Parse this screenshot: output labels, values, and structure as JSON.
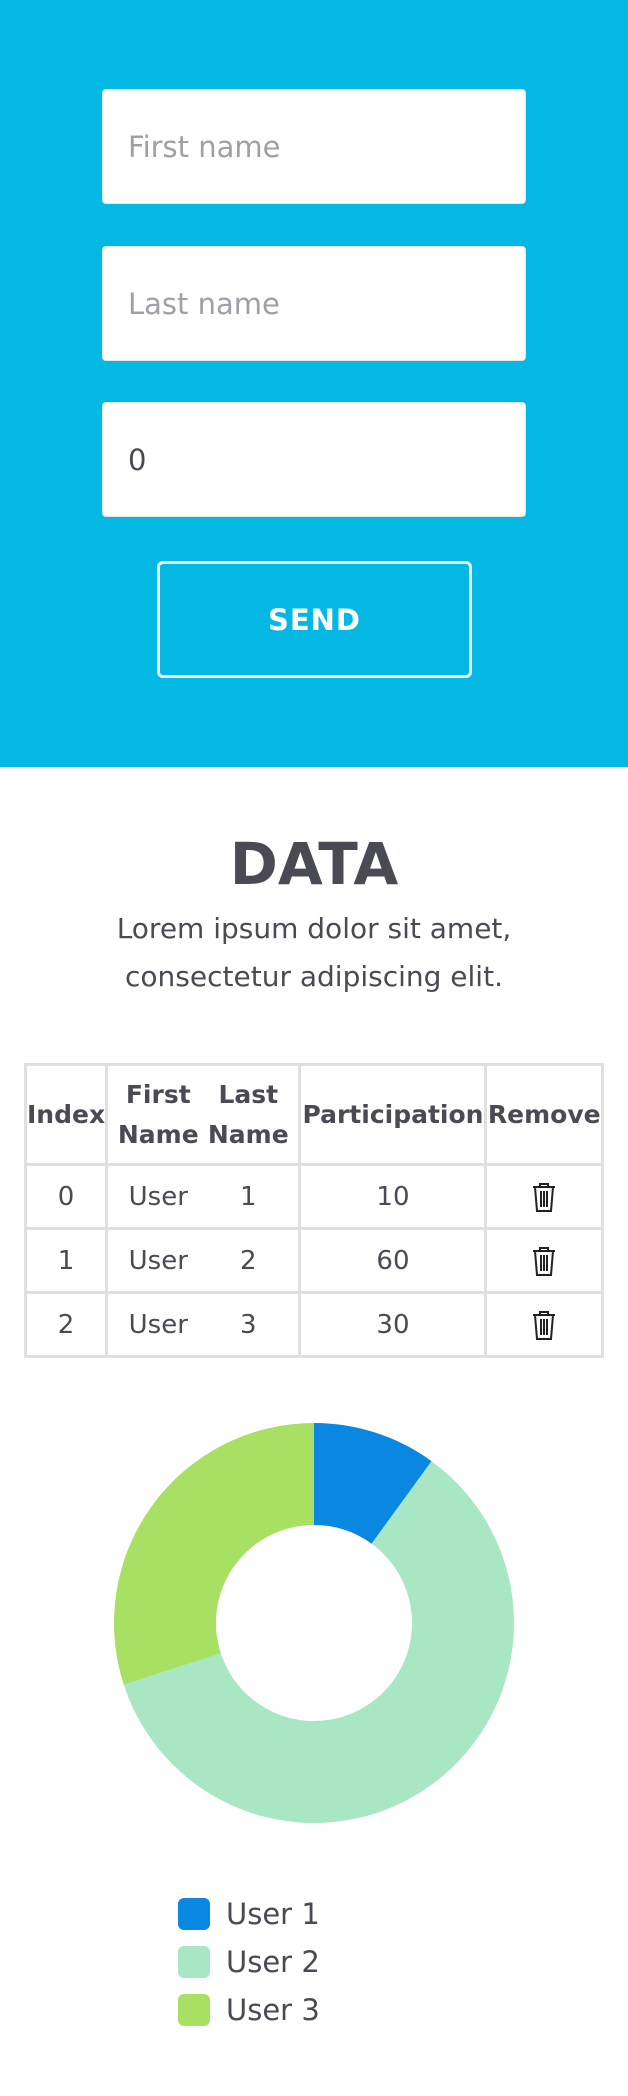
{
  "form": {
    "first_name_placeholder": "First name",
    "last_name_placeholder": "Last name",
    "participation_value": "0",
    "send_label": "SEND"
  },
  "section": {
    "title": "DATA",
    "description": "Lorem ipsum dolor sit amet, consectetur adipiscing elit."
  },
  "table": {
    "headers": {
      "index": "Index",
      "first_name": "First Name",
      "last_name": "Last Name",
      "participation": "Participation",
      "remove": "Remove"
    },
    "rows": [
      {
        "index": "0",
        "first": "User",
        "last": "1",
        "participation": "10"
      },
      {
        "index": "1",
        "first": "User",
        "last": "2",
        "participation": "60"
      },
      {
        "index": "2",
        "first": "User",
        "last": "3",
        "participation": "30"
      }
    ],
    "remove_icon": "trash-icon"
  },
  "chart_data": {
    "type": "pie",
    "donut": true,
    "categories": [
      "User 1",
      "User 2",
      "User 3"
    ],
    "values": [
      10,
      60,
      30
    ],
    "colors": [
      "#0a87e0",
      "#a8e6c4",
      "#a8e063"
    ],
    "legend_position": "bottom"
  },
  "colors": {
    "hero_background": "#03b8e3",
    "text": "#4a4a55"
  }
}
